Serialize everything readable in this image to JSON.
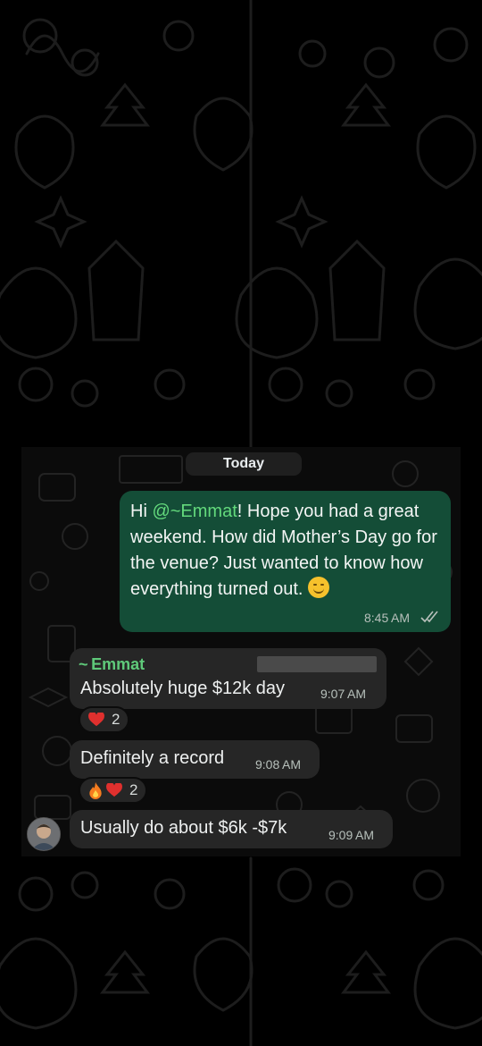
{
  "chat": {
    "date_label": "Today",
    "messages": [
      {
        "direction": "outgoing",
        "text_before_mention": "Hi ",
        "mention": "@~Emmat",
        "text_after_mention": "! Hope you had a great weekend. How did Mother’s Day go for the venue? Just wanted to know how everything turned out.",
        "emoji": "smiling-face-icon",
        "time": "8:45 AM",
        "status": "read"
      },
      {
        "direction": "incoming",
        "sender": "~ Emmat",
        "text": "Absolutely huge $12k day",
        "time": "9:07 AM",
        "reaction": {
          "icons": [
            "heart-icon"
          ],
          "count": "2"
        }
      },
      {
        "direction": "incoming",
        "text": "Definitely a record",
        "time": "9:08 AM",
        "reaction": {
          "icons": [
            "fire-icon",
            "heart-icon"
          ],
          "count": "2"
        }
      },
      {
        "direction": "incoming",
        "text": "Usually do about $6k -$7k",
        "time": "9:09 AM",
        "avatar": "sender-avatar"
      }
    ]
  },
  "colors": {
    "outgoing_bubble": "#144d37",
    "incoming_bubble": "#262626",
    "mention": "#63d97c",
    "background": "#000000"
  }
}
